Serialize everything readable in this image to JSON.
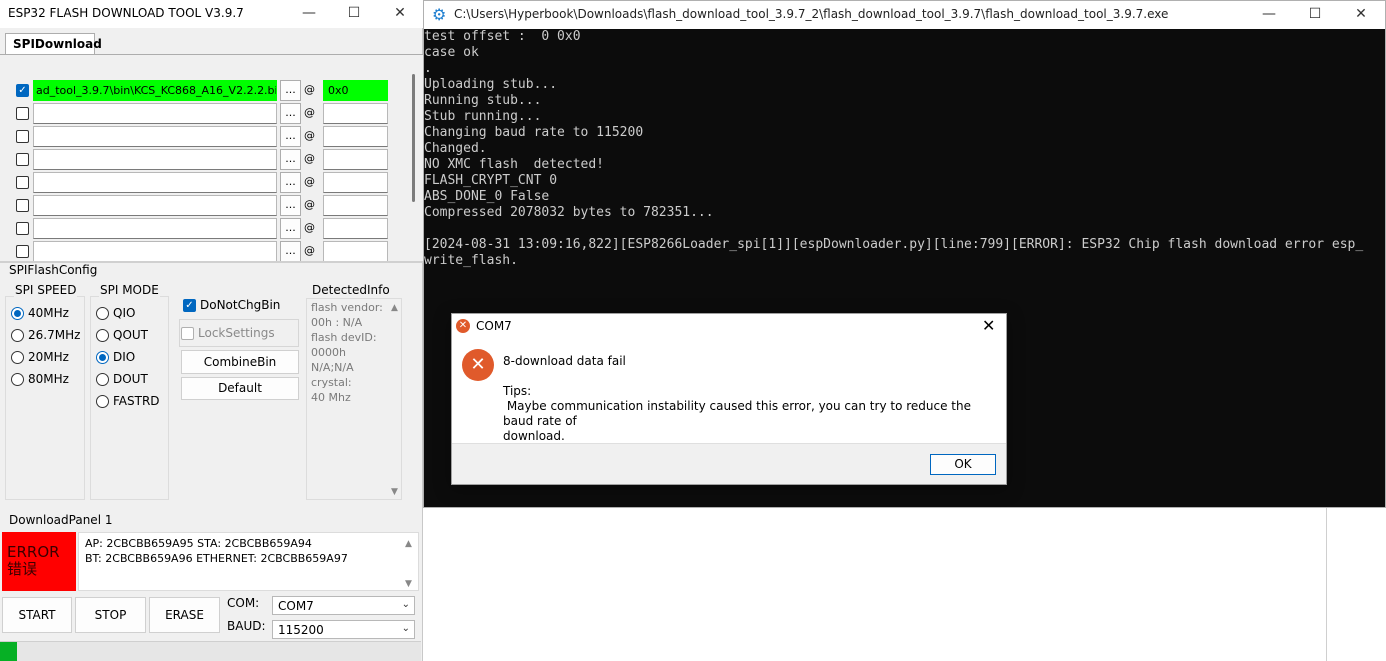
{
  "flash_tool": {
    "title": "ESP32 FLASH DOWNLOAD TOOL V3.9.7",
    "tab_label": "SPIDownload",
    "files": [
      {
        "checked": true,
        "path": "ad_tool_3.9.7\\bin\\KCS_KC868_A16_V2.2.2.bin",
        "dots": "...",
        "at": "@",
        "offset": "0x0"
      },
      {
        "checked": false,
        "path": "",
        "dots": "...",
        "at": "@",
        "offset": ""
      },
      {
        "checked": false,
        "path": "",
        "dots": "...",
        "at": "@",
        "offset": ""
      },
      {
        "checked": false,
        "path": "",
        "dots": "...",
        "at": "@",
        "offset": ""
      },
      {
        "checked": false,
        "path": "",
        "dots": "...",
        "at": "@",
        "offset": ""
      },
      {
        "checked": false,
        "path": "",
        "dots": "...",
        "at": "@",
        "offset": ""
      },
      {
        "checked": false,
        "path": "",
        "dots": "...",
        "at": "@",
        "offset": ""
      },
      {
        "checked": false,
        "path": "",
        "dots": "...",
        "at": "@",
        "offset": ""
      }
    ],
    "spiflashconfig_label": "SPIFlashConfig",
    "spi_speed_label": "SPI SPEED",
    "spi_speed_options": [
      "40MHz",
      "26.7MHz",
      "20MHz",
      "80MHz"
    ],
    "spi_speed_selected": "40MHz",
    "spi_mode_label": "SPI MODE",
    "spi_mode_options": [
      "QIO",
      "QOUT",
      "DIO",
      "DOUT",
      "FASTRD"
    ],
    "spi_mode_selected": "DIO",
    "do_not_chg_bin_label": "DoNotChgBin",
    "lock_settings_label": "LockSettings",
    "combine_bin_label": "CombineBin",
    "default_label": "Default",
    "detected_info_label": "DetectedInfo",
    "detected_info_lines": [
      "flash vendor:",
      "00h : N/A",
      "flash devID:",
      "0000h",
      "N/A;N/A",
      "crystal:",
      "40 Mhz"
    ],
    "download_panel_label": "DownloadPanel 1",
    "status_text": "ERROR",
    "status_text_cn": "错误",
    "status_color": "#ff0000",
    "mac_line1": "AP:  2CBCBB659A95  STA:  2CBCBB659A94",
    "mac_line2": "BT:  2CBCBB659A96  ETHERNET:  2CBCBB659A97",
    "start_label": "START",
    "stop_label": "STOP",
    "erase_label": "ERASE",
    "com_label": "COM:",
    "com_value": "COM7",
    "baud_label": "BAUD:",
    "baud_value": "115200",
    "progress": 0.04,
    "progress_color": "#06b025"
  },
  "console": {
    "title": "C:\\Users\\Hyperbook\\Downloads\\flash_download_tool_3.9.7_2\\flash_download_tool_3.9.7\\flash_download_tool_3.9.7.exe",
    "lines": [
      "test offset :  0 0x0",
      "case ok",
      ".",
      "Uploading stub...",
      "Running stub...",
      "Stub running...",
      "Changing baud rate to 115200",
      "Changed.",
      "NO XMC flash  detected!",
      "FLASH_CRYPT_CNT 0",
      "ABS_DONE_0 False",
      "Compressed 2078032 bytes to 782351...",
      "",
      "[2024-08-31 13:09:16,822][ESP8266Loader_spi[1]][espDownloader.py][line:799][ERROR]: ESP32 Chip flash download error esp_",
      "write_flash."
    ]
  },
  "dialog": {
    "title": "COM7",
    "message": "8-download data fail",
    "tips": "Tips:\n Maybe communication instability caused this error, you can try to reduce the baud rate of\ndownload.",
    "ok_label": "OK",
    "error_color": "#e05a2b"
  },
  "icons": {
    "minimize": "—",
    "maximize": "☐",
    "close": "✕",
    "check": "✓",
    "error_x": "✕",
    "gear": "⚙",
    "chevron_down": "⌄",
    "arrow_up": "▲",
    "arrow_down": "▼"
  }
}
